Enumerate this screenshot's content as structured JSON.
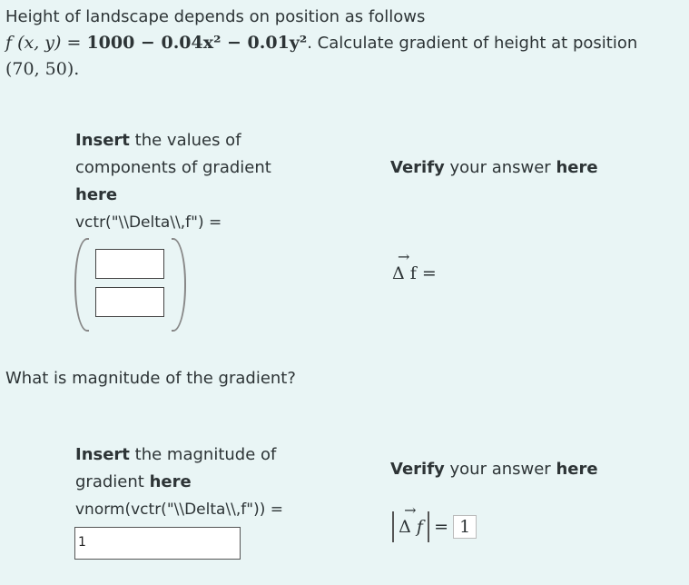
{
  "problem": {
    "intro": "Height of landscape depends on position as follows",
    "func_lhs": "f (x, y) = ",
    "func_rhs": "1000 − 0.04x² − 0.01y²",
    "question_tail": ". Calculate gradient of height at position",
    "position": "(70, 50)",
    "period": "."
  },
  "section1": {
    "insert_bold": "Insert",
    "insert_text": "the values of components of gradient",
    "insert_here": "here",
    "code_label": "vctr(\"\\\\Delta\\\\,f\") =",
    "verify_bold": "Verify",
    "verify_text": "your answer",
    "verify_here": "here",
    "formula": "Δ f =",
    "component_values": [
      "",
      ""
    ]
  },
  "section2": {
    "question": "What is magnitude of the gradient?",
    "insert_bold": "Insert",
    "insert_text": "the magnitude of gradient",
    "insert_here": "here",
    "code_label": "vnorm(vctr(\"\\\\Delta\\\\,f\")) =",
    "input_value": "1",
    "verify_bold": "Verify",
    "verify_text": "your answer",
    "verify_here": "here",
    "formula_eq": "=",
    "answer_display": "1"
  }
}
